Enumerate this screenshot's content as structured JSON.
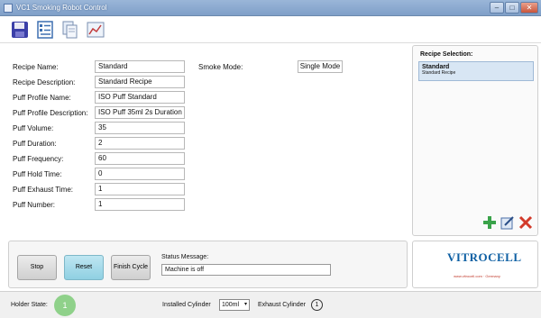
{
  "window": {
    "title": "VC1 Smoking Robot Control"
  },
  "toolbar": {
    "icons": [
      "save-icon",
      "recipe-list-icon",
      "copy-icon",
      "chart-icon"
    ]
  },
  "form": {
    "fields": [
      {
        "label": "Recipe Name:",
        "value": "Standard"
      },
      {
        "label": "Recipe Description:",
        "value": "Standard Recipe"
      },
      {
        "label": "Puff Profile Name:",
        "value": "ISO Puff Standard"
      },
      {
        "label": "Puff Profile Description:",
        "value": "ISO Puff 35ml 2s Duration"
      },
      {
        "label": "Puff Volume:",
        "value": "35"
      },
      {
        "label": "Puff Duration:",
        "value": "2"
      },
      {
        "label": "Puff Frequency:",
        "value": "60"
      },
      {
        "label": "Puff Hold Time:",
        "value": "0"
      },
      {
        "label": "Puff Exhaust Time:",
        "value": "1"
      },
      {
        "label": "Puff Number:",
        "value": "1"
      }
    ],
    "smoke_mode": {
      "label": "Smoke Mode:",
      "value": "Single Mode"
    }
  },
  "recipe_selection": {
    "title": "Recipe Selection:",
    "items": [
      {
        "name": "Standard",
        "description": "Standard Recipe"
      }
    ]
  },
  "controls": {
    "stop_label": "Stop",
    "reset_label": "Reset",
    "finish_label": "Finish Cycle",
    "status_label": "Status Message:",
    "status_value": "Machine is off"
  },
  "logo": {
    "text": "VITROCELL",
    "sub": "www.vitrocell.com · Germany"
  },
  "statusbar": {
    "holder_label": "Holder State:",
    "holder_value": "1",
    "cylinder_label": "Installed Cylinder",
    "cylinder_value": "100ml",
    "exhaust_label": "Exhaust Cylinder",
    "exhaust_value": "1"
  },
  "colors": {
    "accent": "#7f9fc8",
    "reset": "#8fd0e2",
    "holder": "#8fd18a",
    "logo": "#0d5fa3"
  }
}
